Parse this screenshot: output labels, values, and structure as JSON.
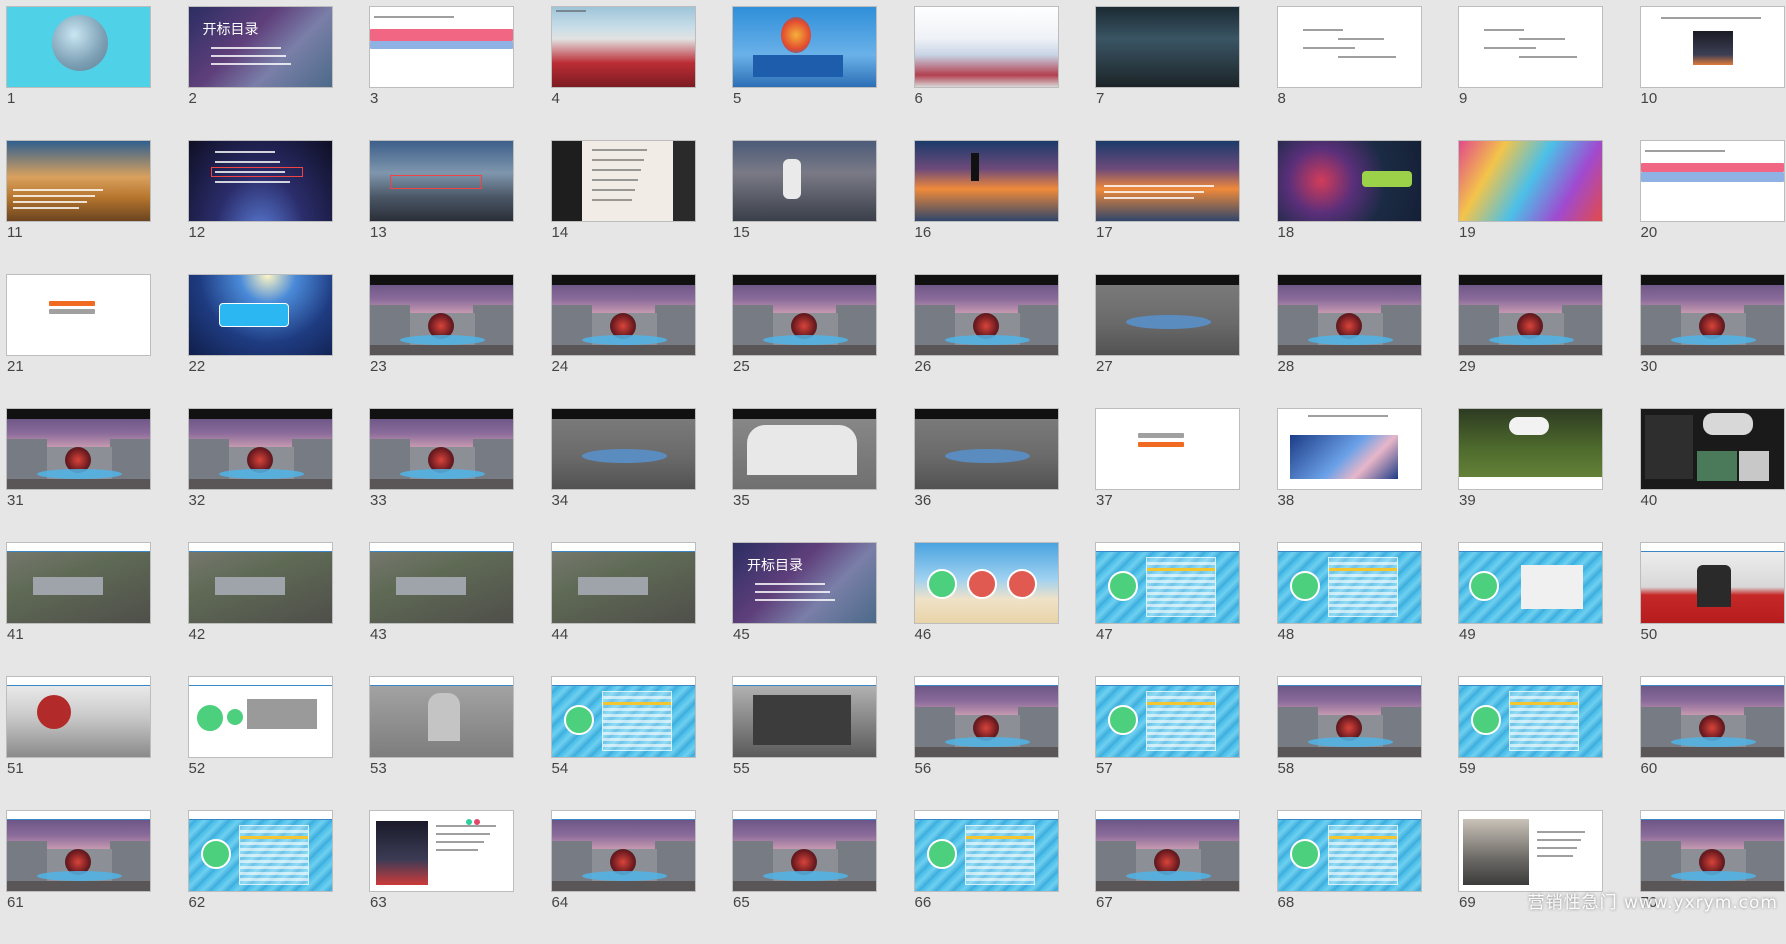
{
  "slides": [
    {
      "n": "1",
      "type": "cover"
    },
    {
      "n": "2",
      "type": "toc",
      "title": "开标目录"
    },
    {
      "n": "3",
      "type": "agenda_pink"
    },
    {
      "n": "4",
      "type": "photo_stage"
    },
    {
      "n": "5",
      "type": "photo_balloon"
    },
    {
      "n": "6",
      "type": "photo_stage_white"
    },
    {
      "n": "7",
      "type": "photo_dark_hall"
    },
    {
      "n": "8",
      "type": "text_white"
    },
    {
      "n": "9",
      "type": "text_white"
    },
    {
      "n": "10",
      "type": "text_image_small"
    },
    {
      "n": "11",
      "type": "photo_pyramids"
    },
    {
      "n": "12",
      "type": "photo_space"
    },
    {
      "n": "13",
      "type": "photo_city"
    },
    {
      "n": "14",
      "type": "photo_silhouette"
    },
    {
      "n": "15",
      "type": "photo_street"
    },
    {
      "n": "16",
      "type": "photo_sunset"
    },
    {
      "n": "17",
      "type": "photo_sunset_text"
    },
    {
      "n": "18",
      "type": "colorful_ring"
    },
    {
      "n": "19",
      "type": "colorful_splash"
    },
    {
      "n": "20",
      "type": "agenda_pink2"
    },
    {
      "n": "21",
      "type": "white_bars"
    },
    {
      "n": "22",
      "type": "spotlight_blue"
    },
    {
      "n": "23",
      "type": "render_stage"
    },
    {
      "n": "24",
      "type": "render_stage"
    },
    {
      "n": "25",
      "type": "render_stage"
    },
    {
      "n": "26",
      "type": "render_stage"
    },
    {
      "n": "27",
      "type": "render_gray"
    },
    {
      "n": "28",
      "type": "render_stage"
    },
    {
      "n": "29",
      "type": "render_stage"
    },
    {
      "n": "30",
      "type": "render_stage"
    },
    {
      "n": "31",
      "type": "render_stage"
    },
    {
      "n": "32",
      "type": "render_stage"
    },
    {
      "n": "33",
      "type": "render_stage"
    },
    {
      "n": "34",
      "type": "render_gray"
    },
    {
      "n": "35",
      "type": "render_white"
    },
    {
      "n": "36",
      "type": "render_gray"
    },
    {
      "n": "37",
      "type": "white_bars2"
    },
    {
      "n": "38",
      "type": "text_sky"
    },
    {
      "n": "39",
      "type": "render_green"
    },
    {
      "n": "40",
      "type": "render_dark_collage"
    },
    {
      "n": "41",
      "type": "render_aerial"
    },
    {
      "n": "42",
      "type": "render_aerial"
    },
    {
      "n": "43",
      "type": "render_aerial"
    },
    {
      "n": "44",
      "type": "render_aerial"
    },
    {
      "n": "45",
      "type": "toc",
      "title": "开标目录"
    },
    {
      "n": "46",
      "type": "beach_bubbles"
    },
    {
      "n": "47",
      "type": "pool_table"
    },
    {
      "n": "48",
      "type": "pool_table"
    },
    {
      "n": "49",
      "type": "pool_figures"
    },
    {
      "n": "50",
      "type": "red_carpet"
    },
    {
      "n": "51",
      "type": "bw_red"
    },
    {
      "n": "52",
      "type": "white_green"
    },
    {
      "n": "53",
      "type": "render_gray_door"
    },
    {
      "n": "54",
      "type": "pool_table"
    },
    {
      "n": "55",
      "type": "render_bw_dark"
    },
    {
      "n": "56",
      "type": "render_stage_hdr"
    },
    {
      "n": "57",
      "type": "pool_table"
    },
    {
      "n": "58",
      "type": "render_stage_hdr"
    },
    {
      "n": "59",
      "type": "pool_table"
    },
    {
      "n": "60",
      "type": "render_stage_hdr"
    },
    {
      "n": "61",
      "type": "render_stage_hdr"
    },
    {
      "n": "62",
      "type": "pool_table"
    },
    {
      "n": "63",
      "type": "white_rocket"
    },
    {
      "n": "64",
      "type": "render_stage_hdr"
    },
    {
      "n": "65",
      "type": "render_stage_hdr"
    },
    {
      "n": "66",
      "type": "pool_table"
    },
    {
      "n": "67",
      "type": "render_stage_hdr"
    },
    {
      "n": "68",
      "type": "pool_table"
    },
    {
      "n": "69",
      "type": "photo_people"
    },
    {
      "n": "70",
      "type": "render_stage_hdr"
    }
  ],
  "watermark": "营销性急门 www.yxrym.com"
}
